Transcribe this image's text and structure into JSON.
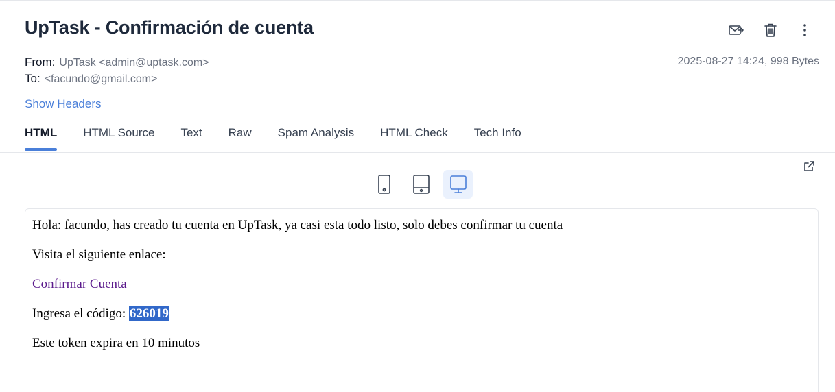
{
  "email": {
    "subject": "UpTask - Confirmación de cuenta",
    "from_label": "From:",
    "from_value": "UpTask <admin@uptask.com>",
    "to_label": "To:",
    "to_value": "<facundo@gmail.com>",
    "date_size": "2025-08-27 14:24, 998 Bytes",
    "show_headers": "Show Headers"
  },
  "actions": {
    "icons": [
      "forward-mail-icon",
      "trash-icon",
      "more-vertical-icon"
    ]
  },
  "tabs": [
    {
      "label": "HTML",
      "active": true
    },
    {
      "label": "HTML Source",
      "active": false
    },
    {
      "label": "Text",
      "active": false
    },
    {
      "label": "Raw",
      "active": false
    },
    {
      "label": "Spam Analysis",
      "active": false
    },
    {
      "label": "HTML Check",
      "active": false
    },
    {
      "label": "Tech Info",
      "active": false
    }
  ],
  "device_switch": {
    "options": [
      "mobile",
      "tablet",
      "desktop"
    ],
    "selected": "desktop"
  },
  "body": {
    "line1": "Hola: facundo, has creado tu cuenta en UpTask, ya casi esta todo listo, solo debes confirmar tu cuenta",
    "line2": "Visita el siguiente enlace:",
    "link": "Confirmar Cuenta",
    "code_label": "Ingresa el código: ",
    "code": "626019",
    "line5": "Este token expira en 10 minutos"
  },
  "colors": {
    "accent": "#4a7fd9",
    "highlight": "#3168c9",
    "link_visited": "#5b1a8c"
  }
}
